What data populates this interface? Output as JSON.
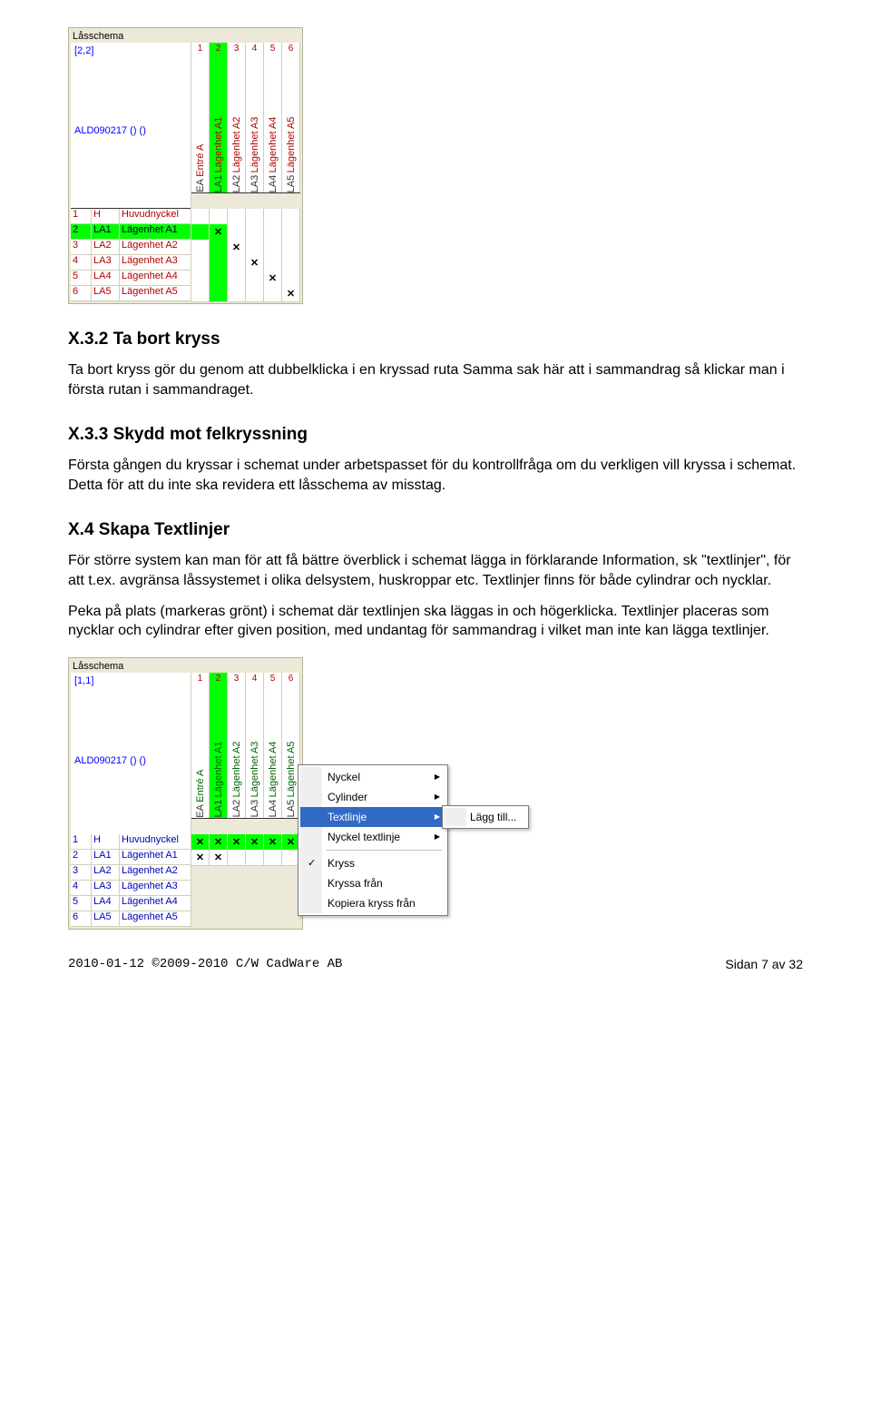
{
  "schemaPanel": {
    "title": "Låsschema",
    "corner": "[2,2]",
    "code": "ALD090217 () ()",
    "columns": [
      {
        "short": "EA",
        "long": "Entré A",
        "num": "1"
      },
      {
        "short": "LA1",
        "long": "Lägenhet A1",
        "num": "2",
        "green": true
      },
      {
        "short": "LA2",
        "long": "Lägenhet A2",
        "num": "3"
      },
      {
        "short": "LA3",
        "long": "Lägenhet A3",
        "num": "4"
      },
      {
        "short": "LA4",
        "long": "Lägenhet A4",
        "num": "5"
      },
      {
        "short": "LA5",
        "long": "Lägenhet A5",
        "num": "6"
      }
    ],
    "rows": [
      {
        "n": "1",
        "code": "H",
        "name": "Huvudnyckel",
        "sel": false,
        "cells": [
          "",
          "",
          "",
          "",
          "",
          ""
        ]
      },
      {
        "n": "2",
        "code": "LA1",
        "name": "Lägenhet A1",
        "sel": true,
        "cells": [
          "g",
          "gx",
          "",
          "",
          "",
          ""
        ]
      },
      {
        "n": "3",
        "code": "LA2",
        "name": "Lägenhet A2",
        "sel": false,
        "cells": [
          "",
          "g",
          "x",
          "",
          "",
          ""
        ]
      },
      {
        "n": "4",
        "code": "LA3",
        "name": "Lägenhet A3",
        "sel": false,
        "cells": [
          "",
          "g",
          "",
          "x",
          "",
          ""
        ]
      },
      {
        "n": "5",
        "code": "LA4",
        "name": "Lägenhet A4",
        "sel": false,
        "cells": [
          "",
          "g",
          "",
          "",
          "x",
          ""
        ]
      },
      {
        "n": "6",
        "code": "LA5",
        "name": "Lägenhet A5",
        "sel": false,
        "cells": [
          "",
          "g",
          "",
          "",
          "",
          "x"
        ]
      }
    ]
  },
  "sections": {
    "s1_title": "X.3.2 Ta bort kryss",
    "s1_p": "Ta bort kryss gör du genom att dubbelklicka i en kryssad ruta Samma sak här att i sammandrag så klickar man i första rutan i sammandraget.",
    "s2_title": "X.3.3 Skydd mot felkryssning",
    "s2_p": "Första gången du kryssar i schemat under arbetspasset för du kontrollfråga om du verkligen vill kryssa i schemat. Detta för att du inte ska revidera ett låsschema av misstag.",
    "s3_title": "X.4 Skapa Textlinjer",
    "s3_p1": "För större system kan man för att få bättre överblick i schemat lägga in förklarande Information, sk \"textlinjer\", för att t.ex. avgränsa låssystemet i olika delsystem, huskroppar etc. Textlinjer finns för både cylindrar och nycklar.",
    "s3_p2": "Peka på plats (markeras grönt) i schemat där textlinjen ska läggas in och högerklicka. Textlinjer placeras som nycklar och cylindrar efter given position, med undantag för sammandrag i vilket man inte kan lägga textlinjer."
  },
  "schemaPanel2": {
    "title": "Låsschema",
    "corner": "[1,1]",
    "code": "ALD090217 () ()",
    "rows": [
      {
        "n": "1",
        "code": "H",
        "name": "Huvudnyckel",
        "cells": [
          "gx",
          "gx",
          "gx",
          "gx",
          "gx",
          "gx"
        ]
      },
      {
        "n": "2",
        "code": "LA1",
        "name": "Lägenhet A1",
        "cells": [
          "x",
          "x",
          "",
          "",
          "",
          ""
        ]
      },
      {
        "n": "3",
        "code": "LA2",
        "name": "Lägenhet A2"
      },
      {
        "n": "4",
        "code": "LA3",
        "name": "Lägenhet A3"
      },
      {
        "n": "5",
        "code": "LA4",
        "name": "Lägenhet A4"
      },
      {
        "n": "6",
        "code": "LA5",
        "name": "Lägenhet A5"
      }
    ]
  },
  "contextMenu": {
    "items": [
      {
        "label": "Nyckel",
        "arrow": true
      },
      {
        "label": "Cylinder",
        "arrow": true
      },
      {
        "label": "Textlinje",
        "arrow": true,
        "sel": true
      },
      {
        "label": "Nyckel textlinje",
        "arrow": true
      }
    ],
    "items2": [
      {
        "label": "Kryss",
        "check": true
      },
      {
        "label": "Kryssa från"
      },
      {
        "label": "Kopiera kryss från"
      }
    ],
    "submenu": "Lägg till..."
  },
  "footer": {
    "left": "2010-01-12 ©2009-2010 C/W CadWare AB",
    "right": "Sidan 7 av 32"
  }
}
